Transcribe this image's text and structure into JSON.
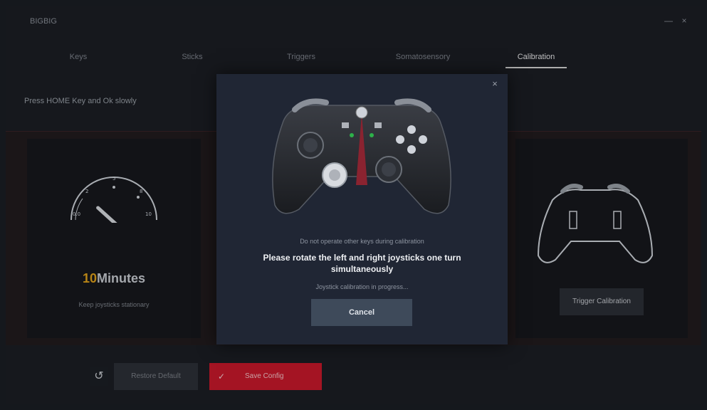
{
  "app": {
    "title": "BIGBIG",
    "minimize_glyph": "—",
    "close_glyph": "×"
  },
  "tabs": [
    {
      "label": "Keys"
    },
    {
      "label": "Sticks"
    },
    {
      "label": "Triggers"
    },
    {
      "label": "Somatosensory"
    },
    {
      "label": "Calibration",
      "active": true
    }
  ],
  "instruction": "Press HOME Key and Ok slowly",
  "gauge": {
    "value_number": "10",
    "value_unit": "Minutes",
    "note": "Keep joysticks stationary",
    "needle_fraction": 0.33
  },
  "trigger_panel": {
    "button_label": "Trigger Calibration"
  },
  "modal": {
    "close_glyph": "×",
    "warning": "Do not operate other keys during calibration",
    "instruction": "Please rotate the left and right joysticks one turn simultaneously",
    "progress": "Joystick calibration in progress...",
    "cancel_label": "Cancel"
  },
  "bottom": {
    "undo_glyph": "↺",
    "restore_label": "Restore Default",
    "save_check_glyph": "✓",
    "save_label": "Save Config"
  },
  "colors": {
    "accent": "#e0a21c",
    "danger": "#c8192b",
    "cancel_bg": "#3e4a5a"
  },
  "icons": [
    "undo-icon",
    "check-icon",
    "close-icon",
    "controller-icon",
    "gauge-icon"
  ]
}
